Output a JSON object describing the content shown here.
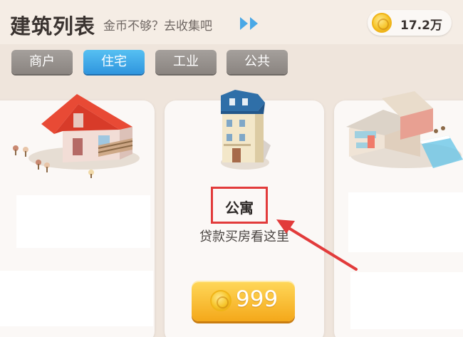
{
  "header": {
    "title": "建筑列表",
    "subtitle": "金币不够？去收集吧",
    "coin_amount": "17.2万"
  },
  "tabs": [
    {
      "label": "商户",
      "active": false
    },
    {
      "label": "住宅",
      "active": true
    },
    {
      "label": "工业",
      "active": false
    },
    {
      "label": "公共",
      "active": false
    }
  ],
  "cards": {
    "selected": {
      "name": "公寓",
      "description": "贷款买房看这里",
      "price": "999"
    }
  },
  "colors": {
    "accent_tab": "#3aa6e8",
    "price_button": "#f7b928",
    "highlight": "#e23b3b"
  }
}
